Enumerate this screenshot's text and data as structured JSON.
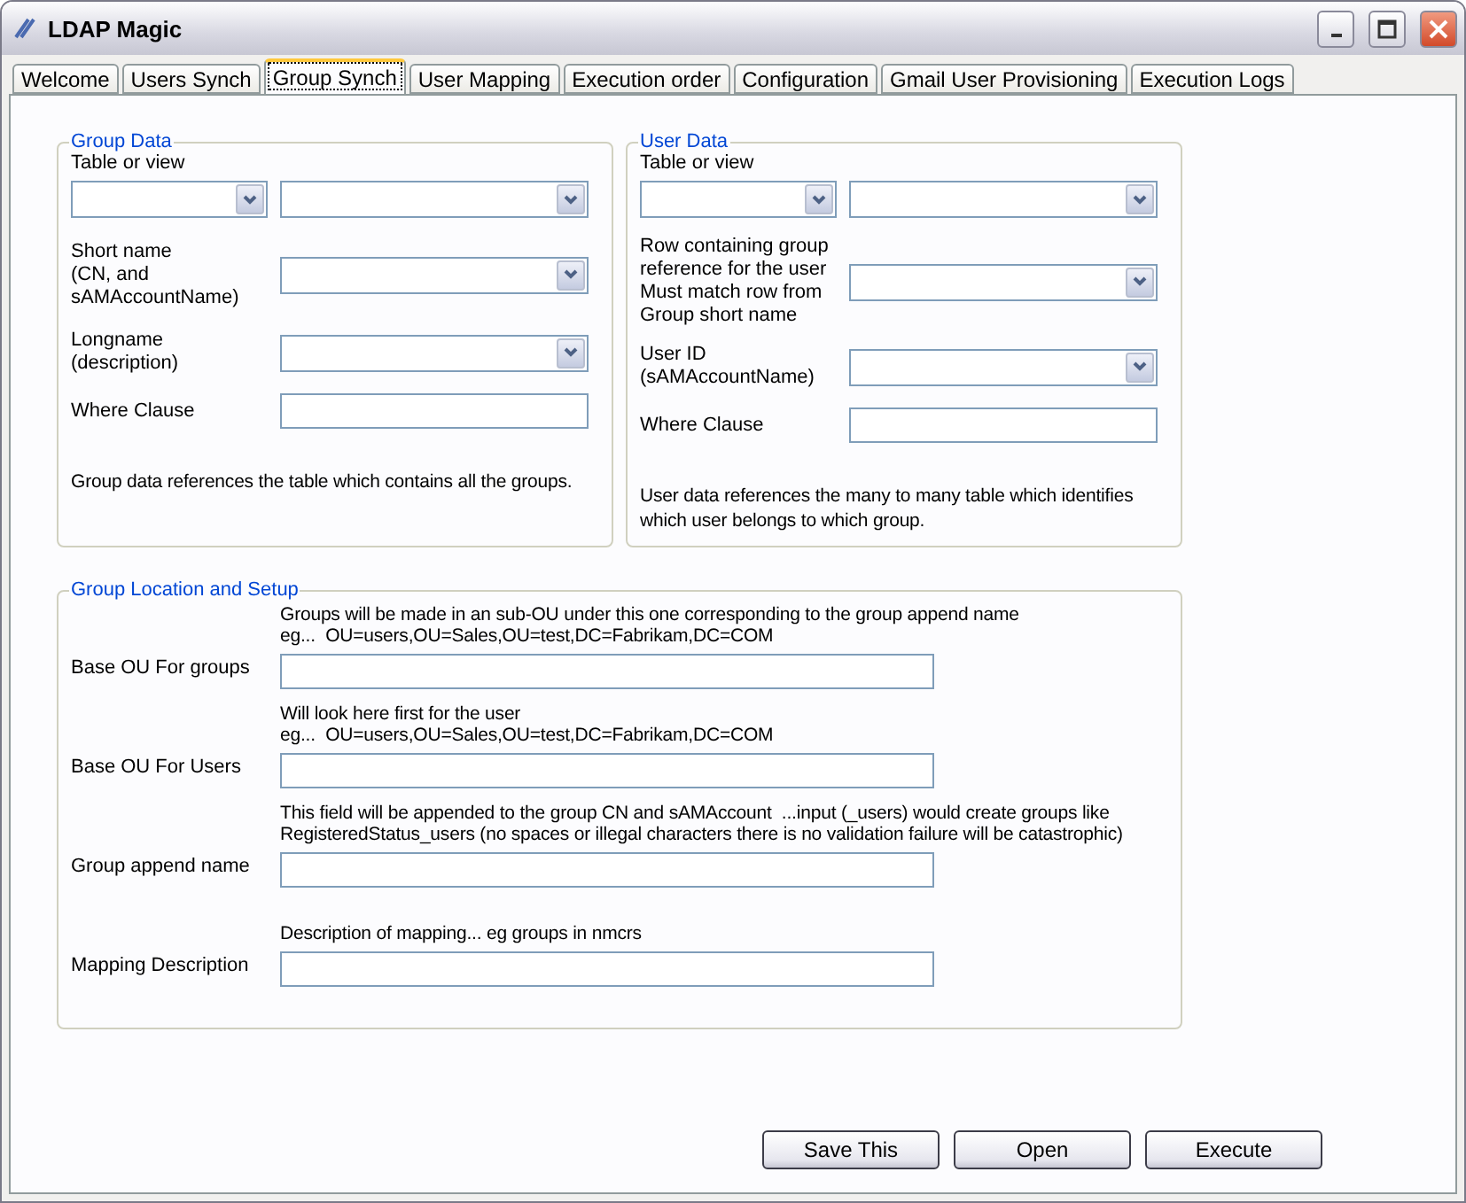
{
  "window": {
    "title": "LDAP Magic"
  },
  "tabs": [
    {
      "label": "Welcome",
      "selected": false
    },
    {
      "label": "Users Synch",
      "selected": false
    },
    {
      "label": "Group Synch",
      "selected": true
    },
    {
      "label": "User Mapping",
      "selected": false
    },
    {
      "label": "Execution order",
      "selected": false
    },
    {
      "label": "Configuration",
      "selected": false
    },
    {
      "label": "Gmail User Provisioning",
      "selected": false
    },
    {
      "label": "Execution Logs",
      "selected": false
    }
  ],
  "group_data": {
    "title": "Group Data",
    "rows": [
      {
        "kind": "combo_pair",
        "label": "Table or view"
      },
      {
        "kind": "combo",
        "label": "Short name\n(CN, and\nsAMAccountName)"
      },
      {
        "kind": "combo",
        "label": "Longname\n(description)"
      },
      {
        "kind": "text",
        "label": "Where Clause"
      }
    ],
    "note": "Group data references the table which contains all the groups."
  },
  "user_data": {
    "title": "User Data",
    "rows": [
      {
        "kind": "combo_pair",
        "label": "Table or view"
      },
      {
        "kind": "combo",
        "label": "Row containing group\nreference for the user\nMust match row from\nGroup short name"
      },
      {
        "kind": "combo",
        "label": "User ID\n(sAMAccountName)"
      },
      {
        "kind": "text",
        "label": "Where Clause"
      }
    ],
    "note": "User data references the many to many table which identifies\nwhich user belongs to which group."
  },
  "location": {
    "title": "Group Location and Setup",
    "rows": [
      {
        "hint": "Groups will be made in an sub-OU under this one corresponding to the group append name\neg...  OU=users,OU=Sales,OU=test,DC=Fabrikam,DC=COM",
        "label": "Base OU For groups"
      },
      {
        "hint": "Will look here first for the user\neg...  OU=users,OU=Sales,OU=test,DC=Fabrikam,DC=COM",
        "label": "Base OU For Users"
      },
      {
        "hint": "This field will be appended to the group CN and sAMAccount  ...input (_users) would create groups like\nRegisteredStatus_users (no spaces or illegal characters there is no validation failure will be catastrophic)",
        "label": "Group append name"
      },
      {
        "hint": "Description of mapping... eg groups in nmcrs",
        "label": "Mapping Description"
      }
    ]
  },
  "buttons": [
    "Save This",
    "Open",
    "Execute"
  ]
}
